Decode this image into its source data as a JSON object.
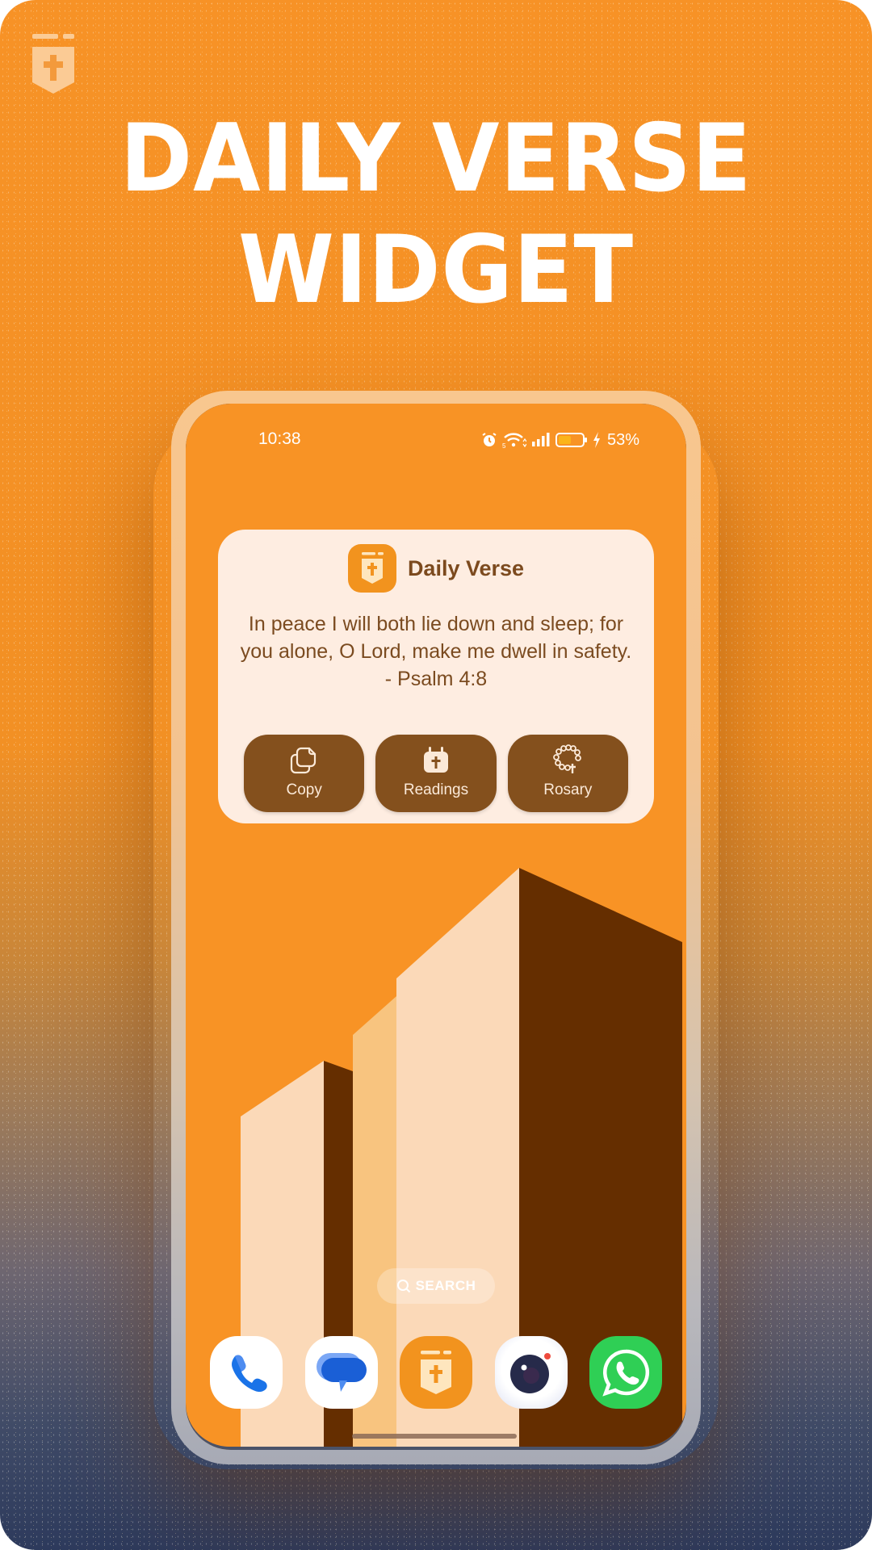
{
  "headline": {
    "line1": "DAILY VERSE",
    "line2": "WIDGET"
  },
  "brand_icon": "bible-cross-icon",
  "colors": {
    "primary_orange": "#F79226",
    "widget_bg": "#FEEDE1",
    "widget_text": "#7B4B20",
    "button_brown": "#84501D",
    "building_dark": "#652E00",
    "building_light": "#FBD9B8",
    "building_mid": "#F8C47F"
  },
  "status_bar": {
    "time": "10:38",
    "icons": [
      "alarm-icon",
      "wifi-icon",
      "signal-icon",
      "battery-icon",
      "charging-icon"
    ],
    "battery_percent": "53%",
    "battery_level": 0.53
  },
  "widget": {
    "title": "Daily Verse",
    "verse_text": "In peace I will both lie down and sleep; for you alone, O Lord, make me dwell in safety.",
    "verse_reference": "- Psalm 4:8",
    "actions": [
      {
        "label": "Copy",
        "icon": "copy-icon"
      },
      {
        "label": "Readings",
        "icon": "calendar-cross-icon"
      },
      {
        "label": "Rosary",
        "icon": "rosary-icon"
      }
    ]
  },
  "search": {
    "label": "SEARCH",
    "icon": "search-icon"
  },
  "dock": {
    "apps": [
      {
        "name": "Phone",
        "icon": "phone-icon"
      },
      {
        "name": "Messages",
        "icon": "messages-icon"
      },
      {
        "name": "Daily Verse",
        "icon": "bible-cross-icon"
      },
      {
        "name": "Camera",
        "icon": "camera-icon"
      },
      {
        "name": "WhatsApp",
        "icon": "whatsapp-icon"
      }
    ]
  }
}
